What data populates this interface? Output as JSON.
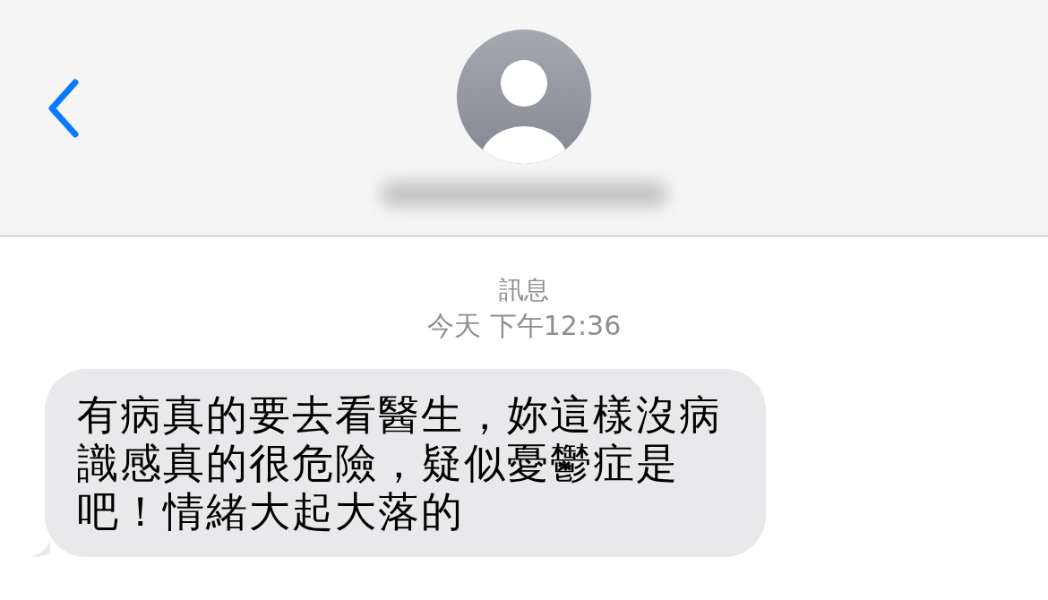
{
  "thread": {
    "service": "訊息",
    "timestamp": {
      "day": "今天",
      "time": "下午12:36"
    },
    "messages": [
      {
        "text": "有病真的要去看醫生，妳這樣沒病識感真的很危險，疑似憂鬱症是吧！情緒大起大落的"
      }
    ]
  }
}
